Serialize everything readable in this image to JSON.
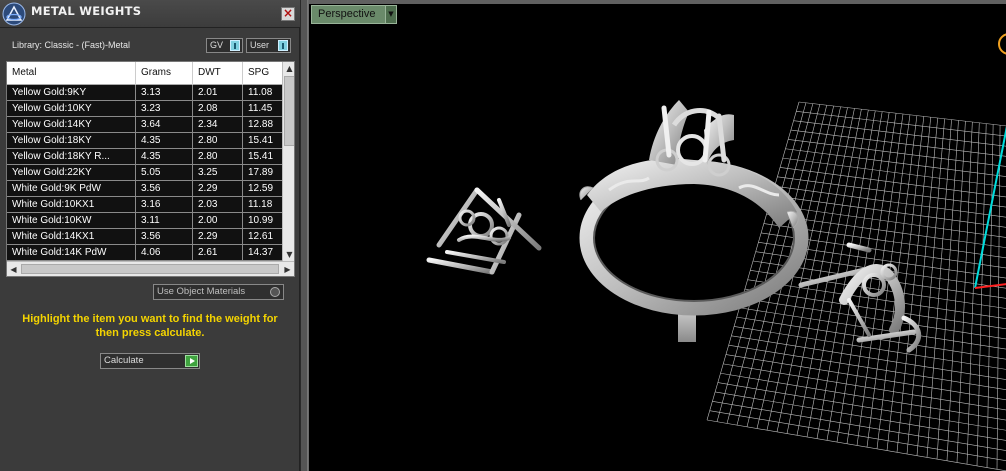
{
  "panel": {
    "title": "METAL WEIGHTS",
    "close_label": "×",
    "library": "Library: Classic - (Fast)-Metal",
    "gv_label": "GV",
    "user_label": "User",
    "use_object_materials": "Use Object Materials",
    "instructions": "Highlight the item you want to find the weight for then press calculate.",
    "calculate_label": "Calculate"
  },
  "table": {
    "headers": [
      "Metal",
      "Grams",
      "DWT",
      "SPG"
    ],
    "rows": [
      [
        "Yellow Gold:9KY",
        "3.13",
        "2.01",
        "11.08"
      ],
      [
        "Yellow Gold:10KY",
        "3.23",
        "2.08",
        "11.45"
      ],
      [
        "Yellow Gold:14KY",
        "3.64",
        "2.34",
        "12.88"
      ],
      [
        "Yellow Gold:18KY",
        "4.35",
        "2.80",
        "15.41"
      ],
      [
        "Yellow Gold:18KY R...",
        "4.35",
        "2.80",
        "15.41"
      ],
      [
        "Yellow Gold:22KY",
        "5.05",
        "3.25",
        "17.89"
      ],
      [
        "White Gold:9K PdW",
        "3.56",
        "2.29",
        "12.59"
      ],
      [
        "White Gold:10KX1",
        "3.16",
        "2.03",
        "11.18"
      ],
      [
        "White Gold:10KW",
        "3.11",
        "2.00",
        "10.99"
      ],
      [
        "White Gold:14KX1",
        "3.56",
        "2.29",
        "12.61"
      ],
      [
        "White Gold:14K PdW",
        "4.06",
        "2.61",
        "14.37"
      ]
    ]
  },
  "viewport": {
    "view_label": "Perspective"
  },
  "colors": {
    "accent_yellow": "#f4d400",
    "row_bg": "#111111",
    "grid": "#c8c8c8",
    "axis_red": "#ff2020",
    "axis_cyan": "#00e0e0"
  }
}
